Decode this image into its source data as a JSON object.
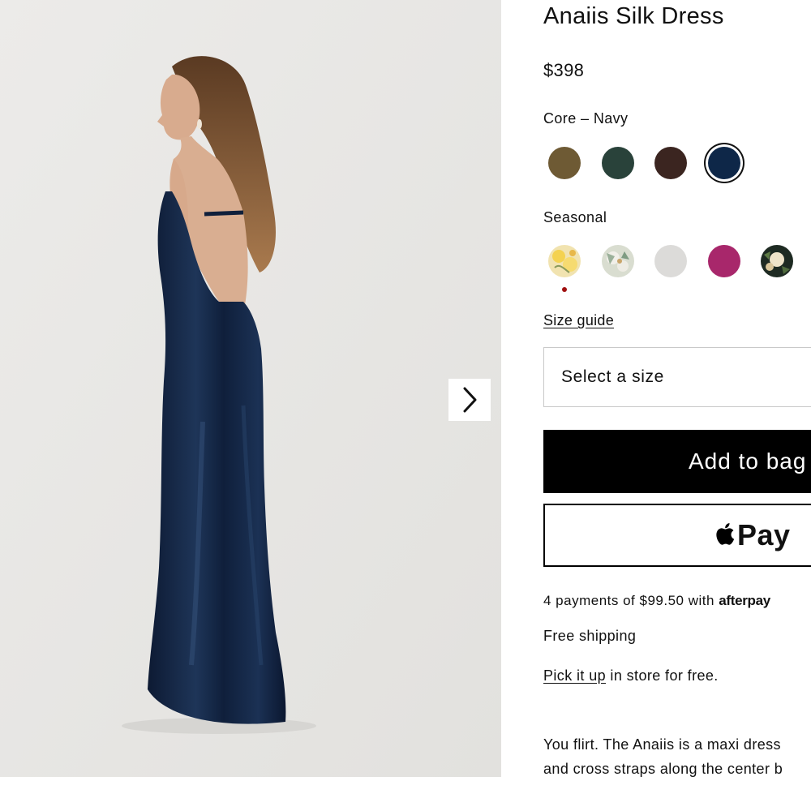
{
  "product": {
    "title": "Anaiis Silk Dress",
    "price": "$398"
  },
  "colors": {
    "core_label": "Core – Navy",
    "core": [
      {
        "name": "olive-swatch",
        "hex": "#6e5a34"
      },
      {
        "name": "forest-green-swatch",
        "hex": "#29423a"
      },
      {
        "name": "chocolate-brown-swatch",
        "hex": "#3b2520"
      },
      {
        "name": "navy-swatch",
        "hex": "#0e2748",
        "selected": true
      }
    ],
    "seasonal_label": "Seasonal",
    "seasonal": [
      {
        "name": "yellow-floral-swatch",
        "hex": "#f1e3b0",
        "new": true
      },
      {
        "name": "sage-floral-swatch",
        "hex": "#d9ddd0"
      },
      {
        "name": "light-grey-swatch",
        "hex": "#dcdbd9"
      },
      {
        "name": "magenta-swatch",
        "hex": "#a8276b"
      },
      {
        "name": "dark-floral-swatch",
        "hex": "#1e2a22"
      }
    ]
  },
  "size": {
    "guide_label": "Size guide",
    "select_placeholder": "Select a size"
  },
  "actions": {
    "add_to_bag": "Add to bag",
    "apple_pay": "Pay"
  },
  "afterpay": {
    "text": "4 payments of $99.50 with ",
    "brand": "afterpay"
  },
  "shipping": "Free shipping",
  "pickup": {
    "link": "Pick it up",
    "text": " in store for free."
  },
  "description": {
    "line1": "You flirt. The Anaiis is a maxi dress",
    "line2": "and cross straps along the center b"
  },
  "gallery": {
    "next_icon": "chevron-right-icon"
  }
}
